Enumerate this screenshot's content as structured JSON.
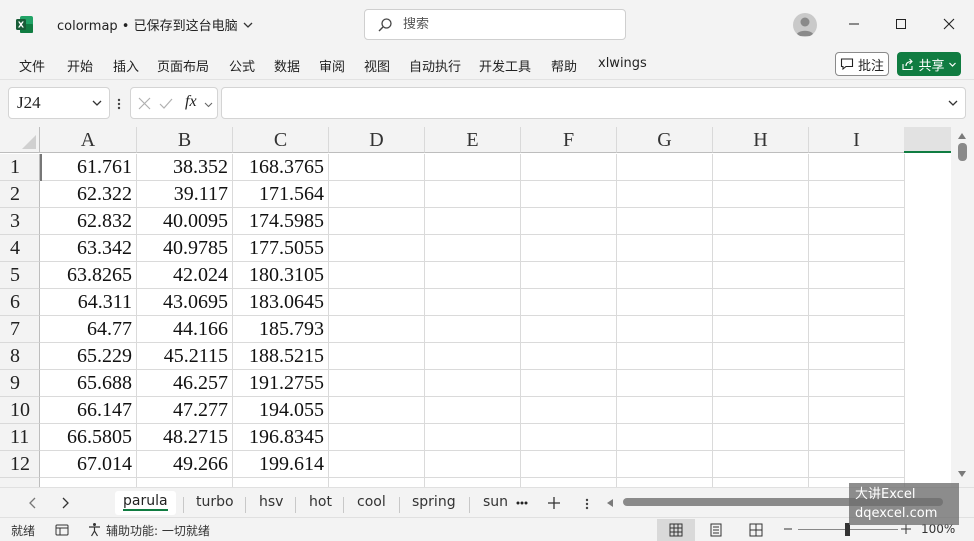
{
  "titlebar": {
    "doc_title": "colormap • 已保存到这台电脑",
    "search_placeholder": "搜索"
  },
  "menu": [
    "文件",
    "开始",
    "插入",
    "页面布局",
    "公式",
    "数据",
    "审阅",
    "视图",
    "自动执行",
    "开发工具",
    "帮助",
    "xlwings"
  ],
  "ribbon_buttons": {
    "comment": "批注",
    "share": "共享"
  },
  "formula_bar": {
    "name_box": "J24",
    "fx": "fx",
    "formula": ""
  },
  "columns": [
    "A",
    "B",
    "C",
    "D",
    "E",
    "F",
    "G",
    "H",
    "I"
  ],
  "rows": [
    {
      "num": "1",
      "a": "61.761",
      "b": "38.352",
      "c": "168.3765"
    },
    {
      "num": "2",
      "a": "62.322",
      "b": "39.117",
      "c": "171.564"
    },
    {
      "num": "3",
      "a": "62.832",
      "b": "40.0095",
      "c": "174.5985"
    },
    {
      "num": "4",
      "a": "63.342",
      "b": "40.9785",
      "c": "177.5055"
    },
    {
      "num": "5",
      "a": "63.8265",
      "b": "42.024",
      "c": "180.3105"
    },
    {
      "num": "6",
      "a": "64.311",
      "b": "43.0695",
      "c": "183.0645"
    },
    {
      "num": "7",
      "a": "64.77",
      "b": "44.166",
      "c": "185.793"
    },
    {
      "num": "8",
      "a": "65.229",
      "b": "45.2115",
      "c": "188.5215"
    },
    {
      "num": "9",
      "a": "65.688",
      "b": "46.257",
      "c": "191.2755"
    },
    {
      "num": "10",
      "a": "66.147",
      "b": "47.277",
      "c": "194.055"
    },
    {
      "num": "11",
      "a": "66.5805",
      "b": "48.2715",
      "c": "196.8345"
    },
    {
      "num": "12",
      "a": "67.014",
      "b": "49.266",
      "c": "199.614"
    }
  ],
  "sheets": [
    {
      "name": "parula",
      "active": true
    },
    {
      "name": "turbo"
    },
    {
      "name": "hsv"
    },
    {
      "name": "hot"
    },
    {
      "name": "cool"
    },
    {
      "name": "spring"
    },
    {
      "name": "sun"
    }
  ],
  "statusbar": {
    "ready": "就绪",
    "accessibility": "辅助功能: 一切就绪",
    "zoom": "100%"
  },
  "watermark": {
    "line1": "大讲Excel",
    "line2": "dqexcel.com"
  },
  "colors": {
    "accent": "#107c41",
    "excel_icon": "#185c37"
  }
}
